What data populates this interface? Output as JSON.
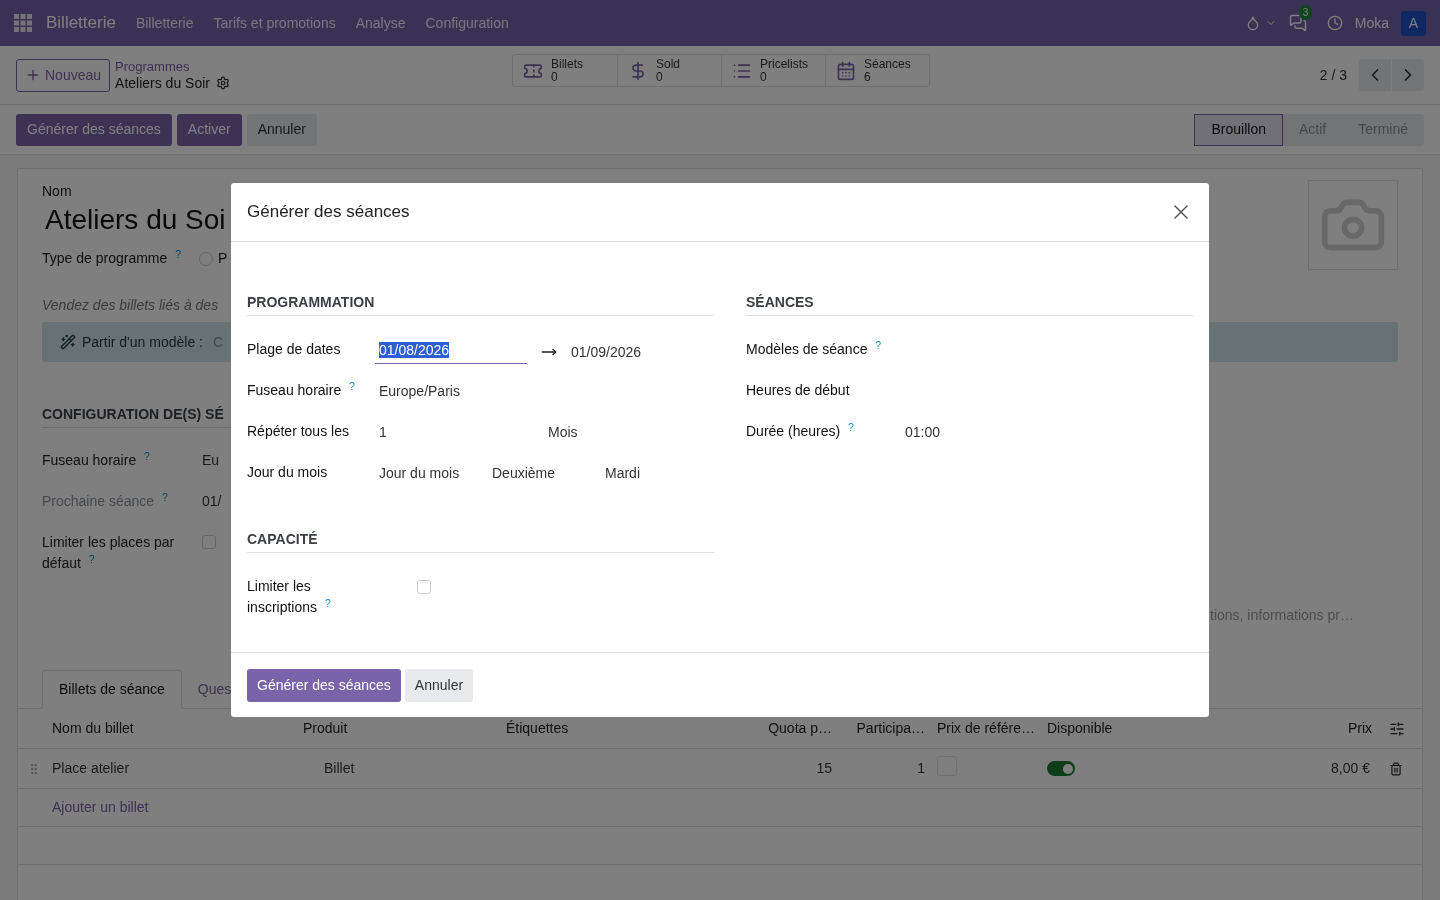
{
  "navbar": {
    "app_name": "Billetterie",
    "menu": [
      "Billetterie",
      "Tarifs et promotions",
      "Analyse",
      "Configuration"
    ],
    "messages_badge": "3",
    "user": "Moka",
    "avatar": "A"
  },
  "control_panel": {
    "new_button": "Nouveau",
    "breadcrumb": "Programmes",
    "record": "Ateliers du Soir",
    "stats": [
      {
        "kind": "ticket",
        "label": "Billets",
        "value": "0"
      },
      {
        "kind": "dollar",
        "label": "Sold",
        "value": "0"
      },
      {
        "kind": "list",
        "label": "Pricelists",
        "value": "0"
      },
      {
        "kind": "calendar",
        "label": "Séances",
        "value": "6"
      }
    ],
    "pager": "2 / 3"
  },
  "actions": [
    {
      "label": "Générer des séances",
      "kind": "primary"
    },
    {
      "label": "Activer",
      "kind": "primary"
    },
    {
      "label": "Annuler",
      "kind": "secondary"
    }
  ],
  "statusbar": [
    {
      "label": "Brouillon",
      "selected": true
    },
    {
      "label": "Actif",
      "selected": false
    },
    {
      "label": "Terminé",
      "selected": false
    }
  ],
  "form": {
    "name_label": "Nom",
    "name_value": "Ateliers du Soi",
    "type_label": "Type de programme $^{?}$",
    "type_option": "P",
    "type_selected": false,
    "description": "Vendez des billets liés à des",
    "template_label": "Partir d'un modèle :",
    "template_value": "C",
    "section": "CONFIGURATION DE(S) SÉ",
    "fields": [
      {
        "label": "Fuseau horaire $^{?}$",
        "value": "Eu",
        "kind": "text",
        "muted": false
      },
      {
        "label": "Prochaine séance $^{?}$",
        "value": "01/",
        "kind": "text",
        "muted": true
      },
      {
        "label": "Limiter les places par défaut $^{?}$",
        "kind": "checkbox",
        "checked": false,
        "muted": false
      }
    ],
    "notes": {
      "placeholder": "tions, informations pr…"
    }
  },
  "tabs": [
    {
      "label": "Billets de séance",
      "selected": true
    },
    {
      "label": "Ques",
      "selected": false
    }
  ],
  "table": {
    "columns": [
      "Nom du billet",
      "Produit",
      "Étiquettes",
      "Quota p…",
      "Participa…",
      "Prix de référe…",
      "Disponible",
      "Prix"
    ],
    "rows": [
      {
        "name": "Place atelier",
        "product": "Billet",
        "quota": "15",
        "participants": "1",
        "reference_price": false,
        "available": true,
        "price": "8,00 €"
      }
    ],
    "add_line": "Ajouter un billet"
  },
  "modal": {
    "title": "Générer des séances",
    "left": [
      {
        "title": "PROGRAMMATION",
        "rows": [
          {
            "kind": "daterange",
            "label": "Plage de dates",
            "start": "01/08/2026",
            "start_selected": true,
            "end": "01/09/2026"
          },
          {
            "kind": "text",
            "label": "Fuseau horaire $^{?}$",
            "value": "Europe/Paris"
          },
          {
            "kind": "multi",
            "label": "Répéter tous les",
            "values": [
              "1",
              "Mois"
            ]
          },
          {
            "kind": "multi",
            "label": "Jour du mois",
            "values": [
              "Jour du mois",
              "Deuxième",
              "Mardi"
            ]
          }
        ]
      },
      {
        "title": "CAPACITÉ",
        "rows": [
          {
            "kind": "checkbox",
            "label": "Limiter les inscriptions $^{?}$",
            "checked": false
          }
        ]
      }
    ],
    "right": [
      {
        "title": "SÉANCES",
        "rows": [
          {
            "kind": "empty",
            "label": "Modèles de séance $^{?}$"
          },
          {
            "kind": "empty",
            "label": "Heures de début"
          },
          {
            "kind": "text",
            "label": "Durée (heures) $^{?}$",
            "value": "01:00"
          }
        ]
      }
    ],
    "buttons": [
      {
        "label": "Générer des séances",
        "kind": "primary"
      },
      {
        "label": "Annuler",
        "kind": "secondary"
      }
    ]
  }
}
